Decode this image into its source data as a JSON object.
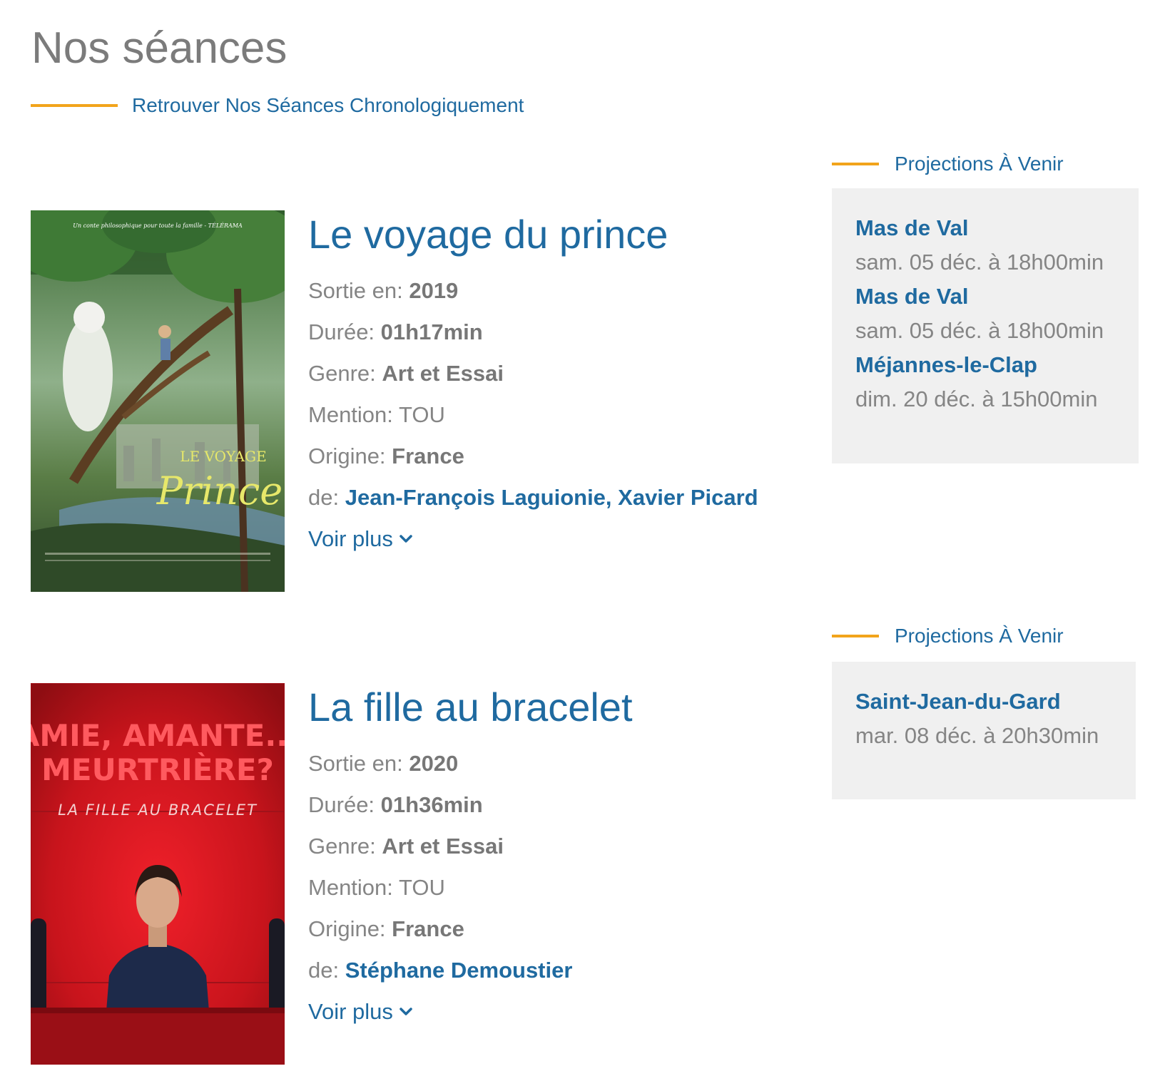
{
  "page": {
    "title": "Nos séances",
    "chrono_link": "Retrouver Nos Séances Chronologiquement"
  },
  "colors": {
    "accent_orange": "#f2a41b",
    "link_blue": "#1f6aa0",
    "text_gray": "#858585",
    "box_bg": "#f0f0f0"
  },
  "films": [
    {
      "title": "Le voyage du prince",
      "sortie_label": "Sortie en:",
      "sortie": "2019",
      "duree_label": "Durée:",
      "duree": "01h17min",
      "genre_label": "Genre:",
      "genre": "Art et Essai",
      "mention_label": "Mention:",
      "mention": "TOU",
      "origine_label": "Origine:",
      "origine": "France",
      "de_label": "de:",
      "directors": "Jean-François Laguionie, Xavier Picard",
      "voir_plus": "Voir plus",
      "poster_text": "Le Voyage du Prince",
      "projections_label": "Projections À Venir",
      "projections": [
        {
          "venue": "Mas de Val",
          "when": "sam. 05 déc. à 18h00min"
        },
        {
          "venue": "Mas de Val",
          "when": "sam. 05 déc. à 18h00min"
        },
        {
          "venue": "Méjannes-le-Clap",
          "when": "dim. 20 déc. à 15h00min"
        }
      ]
    },
    {
      "title": "La fille au bracelet",
      "sortie_label": "Sortie en:",
      "sortie": "2020",
      "duree_label": "Durée:",
      "duree": "01h36min",
      "genre_label": "Genre:",
      "genre": "Art et Essai",
      "mention_label": "Mention:",
      "mention": "TOU",
      "origine_label": "Origine:",
      "origine": "France",
      "de_label": "de:",
      "directors": "Stéphane Demoustier",
      "voir_plus": "Voir plus",
      "poster_headline_1": "AMIE, AMANTE...",
      "poster_headline_2": "MEURTRIÈRE?",
      "poster_subtitle": "LA FILLE AU BRACELET",
      "projections_label": "Projections À Venir",
      "projections": [
        {
          "venue": "Saint-Jean-du-Gard",
          "when": "mar. 08 déc. à 20h30min"
        }
      ]
    }
  ]
}
